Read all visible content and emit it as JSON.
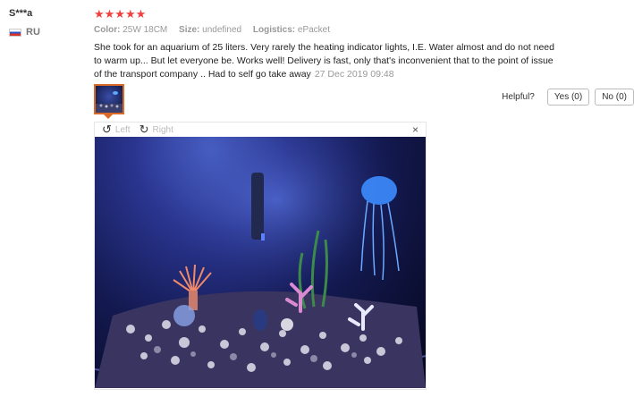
{
  "review": {
    "user": "S***a",
    "country": "RU",
    "stars": "★★★★★",
    "color_label": "Color:",
    "color_value": "25W 18CM",
    "size_label": "Size:",
    "size_value": "undefined",
    "logistics_label": "Logistics:",
    "logistics_value": "ePacket",
    "text": "She took for an aquarium of 25 liters. Very rarely the heating indicator lights, I.E. Water almost and do not need to warm up... But let everyone be. Works well! Delivery is fast, only that's inconvenient that to the point of issue of the transport company .. Had to self go take away",
    "date": "27 Dec 2019 09:48"
  },
  "helpful": {
    "label": "Helpful?",
    "yes": "Yes (0)",
    "no": "No (0)"
  },
  "viewer": {
    "left": "Left",
    "right": "Right",
    "close": "×"
  },
  "icons": [
    "rotate-left-icon",
    "rotate-right-icon",
    "close-icon"
  ]
}
